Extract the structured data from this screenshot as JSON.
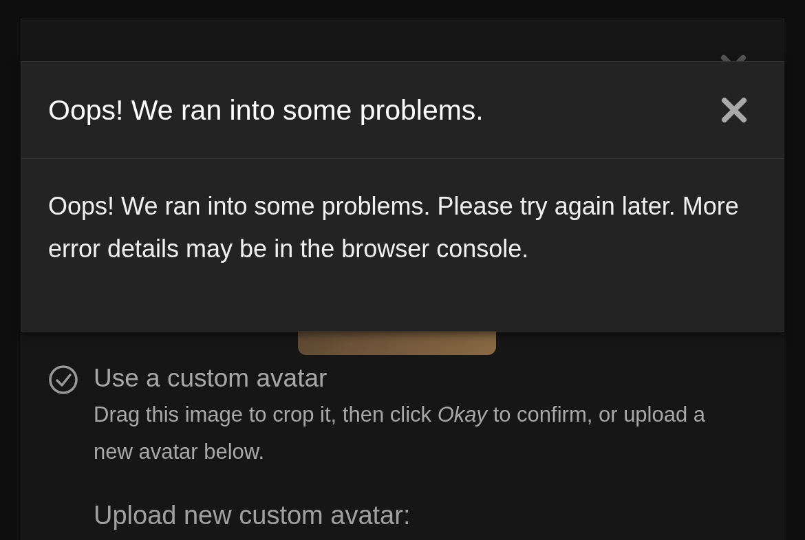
{
  "error_dialog": {
    "title": "Oops! We ran into some problems.",
    "message": "Oops! We ran into some problems. Please try again later. More error details may be in the browser console."
  },
  "avatar_dialog": {
    "option": {
      "label": "Use a custom avatar",
      "checked": true,
      "description": "Drag this image to crop it, then click *Okay* to confirm, or upload a new avatar below."
    },
    "upload_label": "Upload new custom avatar:"
  }
}
